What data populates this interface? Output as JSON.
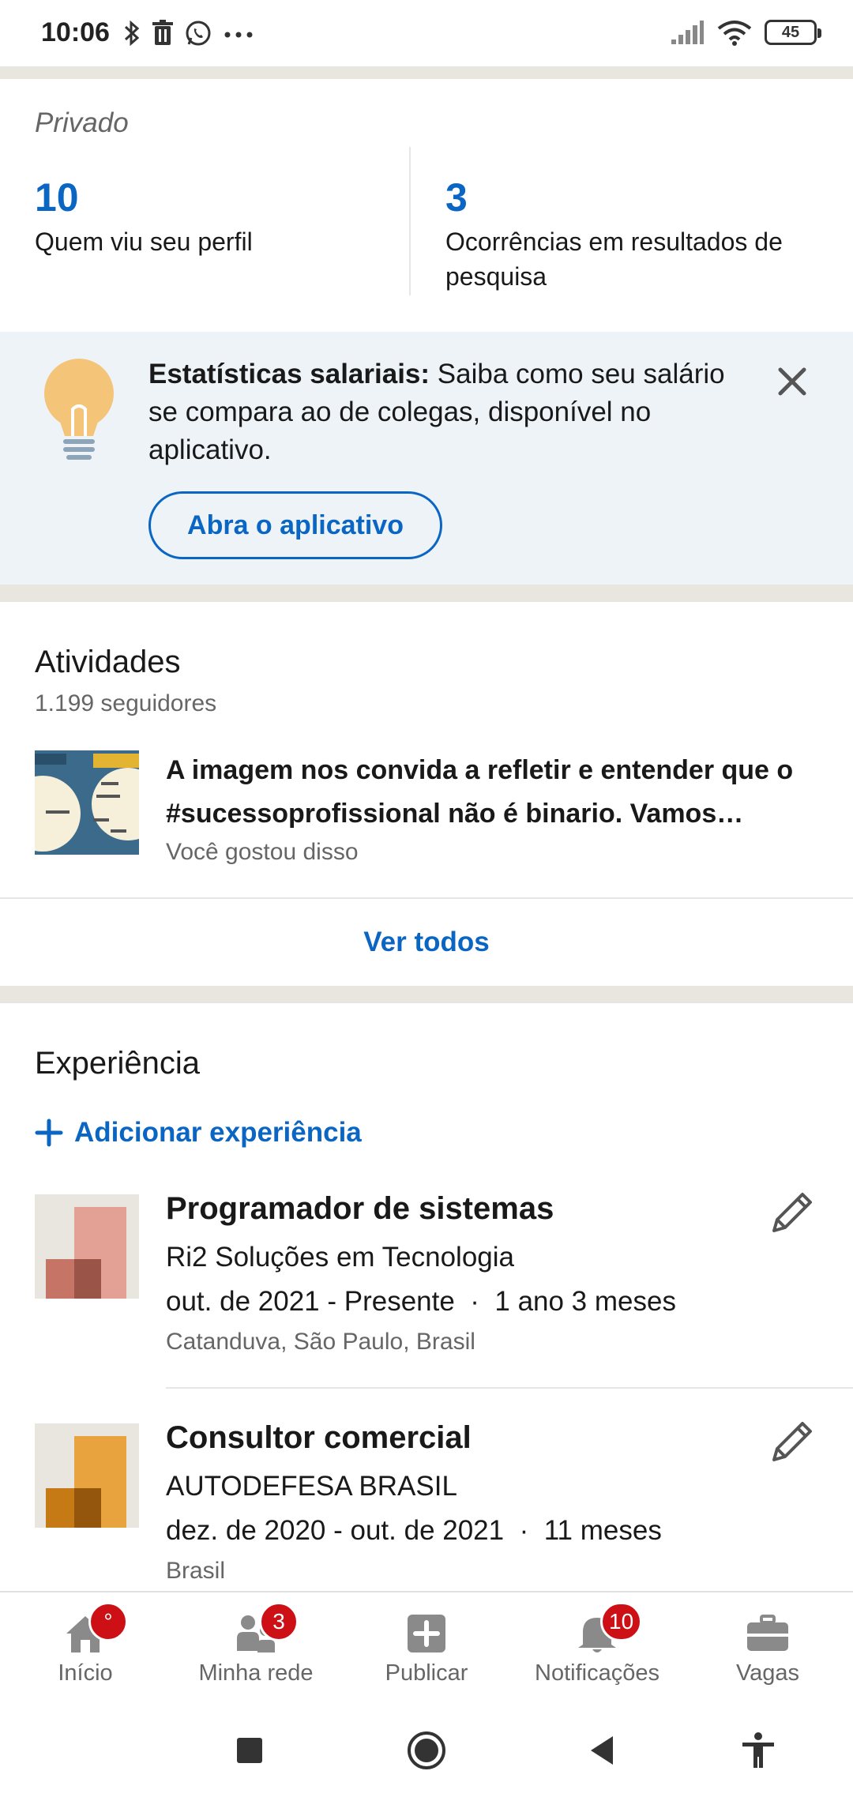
{
  "status_bar": {
    "time": "10:06",
    "icons_left": [
      "bluetooth-icon",
      "trash-icon",
      "whatsapp-icon",
      "more-icon"
    ],
    "icons_right": [
      "signal-icon",
      "wifi-icon",
      "battery-icon"
    ],
    "battery": "45"
  },
  "analytics": {
    "visibility": "Privado",
    "profile_views": {
      "value": "10",
      "label": "Quem viu seu perfil"
    },
    "search_appearances": {
      "value": "3",
      "label": "Ocorrências em resultados de pesquisa"
    }
  },
  "salary_card": {
    "title": "Estatísticas salariais:",
    "text": " Saiba como seu salário se compara ao de colegas, disponível no aplicativo.",
    "button": "Abra o aplicativo"
  },
  "activities": {
    "title": "Atividades",
    "followers": "1.199 seguidores",
    "post": {
      "text": "A imagem nos convida a refletir e entender que o #sucessoprofissional não é binario. Vamos…",
      "subtext": "Você gostou disso"
    },
    "see_all": "Ver todos"
  },
  "experience": {
    "title": "Experiência",
    "add_label": "Adicionar experiência",
    "items": [
      {
        "title": "Programador de sistemas",
        "company": "Ri2 Soluções em Tecnologia",
        "dates": "out. de 2021 - Presente",
        "duration": "1 ano 3 meses",
        "location": "Catanduva, São Paulo, Brasil",
        "logo_color": "#e3a195"
      },
      {
        "title": "Consultor comercial",
        "company": "AUTODEFESA BRASIL",
        "dates": "dez. de 2020 - out. de 2021",
        "duration": "11 meses",
        "location": "Brasil",
        "logo_color": "#e8a23e"
      }
    ]
  },
  "bottom_nav": {
    "items": [
      {
        "label": "Início",
        "badge": "°"
      },
      {
        "label": "Minha rede",
        "badge": "3"
      },
      {
        "label": "Publicar",
        "badge": ""
      },
      {
        "label": "Notificações",
        "badge": "10"
      },
      {
        "label": "Vagas",
        "badge": ""
      }
    ]
  },
  "colors": {
    "accent": "#0a66c2",
    "badge": "#cc1016",
    "divider": "#e9e5df",
    "card_bg": "#eef3f8"
  }
}
